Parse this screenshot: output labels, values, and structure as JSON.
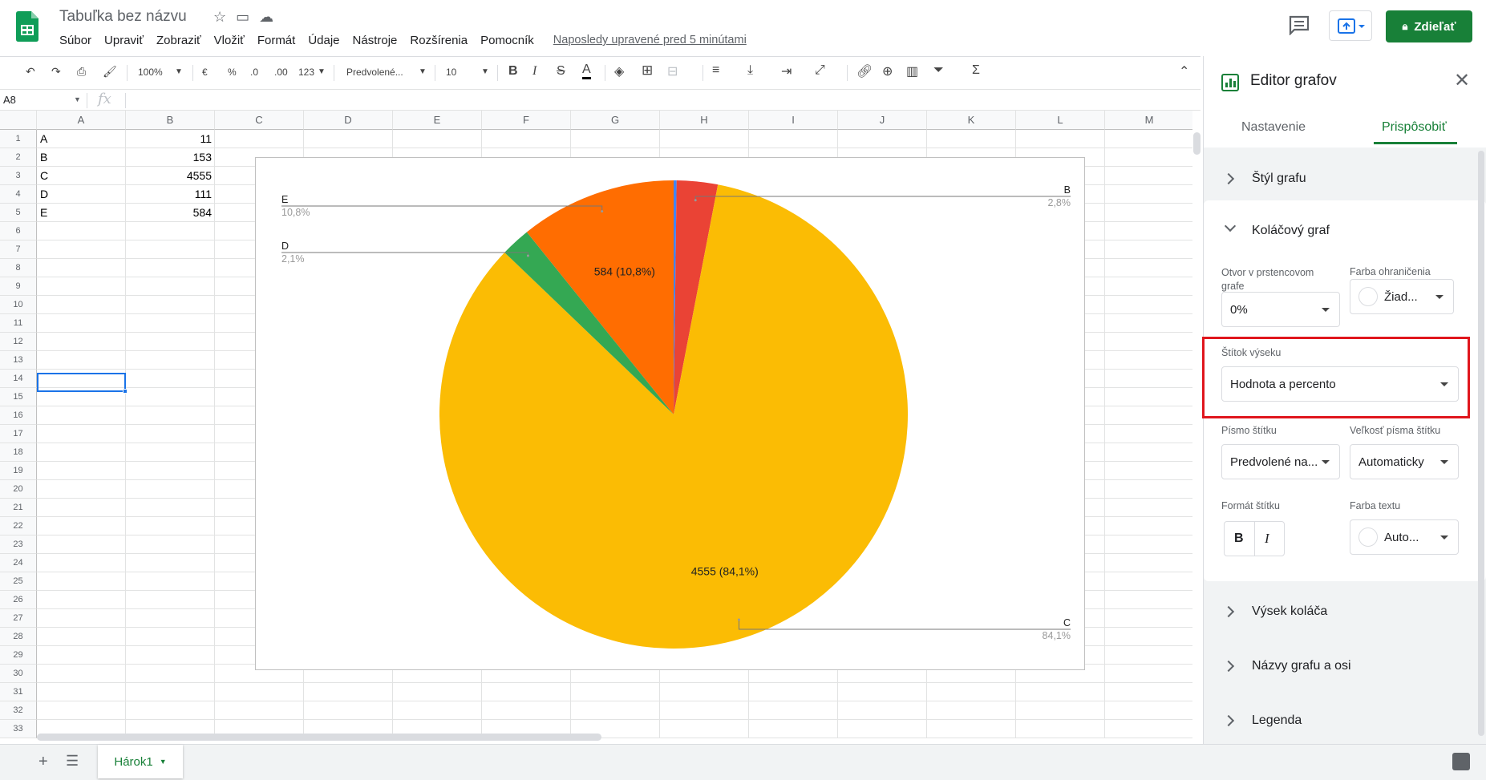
{
  "header": {
    "doc_title": "Tabuľka bez názvu",
    "menu": [
      "Súbor",
      "Upraviť",
      "Zobraziť",
      "Vložiť",
      "Formát",
      "Údaje",
      "Nástroje",
      "Rozšírenia",
      "Pomocník"
    ],
    "last_edit": "Naposledy upravené pred 5 minútami",
    "share_label": "Zdieľať"
  },
  "toolbar": {
    "zoom": "100%",
    "currency": "€",
    "percent": "%",
    "dec_decrease": ".0",
    "dec_increase": ".00",
    "format_more": "123",
    "font": "Predvolené...",
    "font_size": "10"
  },
  "formula_bar": {
    "namebox": "A8",
    "fx": "fx"
  },
  "grid": {
    "columns": [
      "A",
      "B",
      "C",
      "D",
      "E",
      "F",
      "G",
      "H",
      "I",
      "J",
      "K",
      "L",
      "M"
    ],
    "row_count": 33,
    "data": [
      {
        "label": "A",
        "value": "11"
      },
      {
        "label": "B",
        "value": "153"
      },
      {
        "label": "C",
        "value": "4555"
      },
      {
        "label": "D",
        "value": "111"
      },
      {
        "label": "E",
        "value": "584"
      }
    ]
  },
  "chart_data": {
    "type": "pie",
    "categories": [
      "A",
      "B",
      "C",
      "D",
      "E"
    ],
    "values": [
      11,
      153,
      4555,
      111,
      584
    ],
    "colors": [
      "#4285f4",
      "#ea4335",
      "#fbbc04",
      "#34a853",
      "#ff6d01"
    ],
    "inside_labels": {
      "C": "4555 (84,1%)",
      "E": "584 (10,8%)"
    },
    "outside_labels": [
      {
        "name": "B",
        "pct": "2,8%",
        "side": "right"
      },
      {
        "name": "E",
        "pct": "10,8%",
        "side": "left"
      },
      {
        "name": "D",
        "pct": "2,1%",
        "side": "left"
      },
      {
        "name": "C",
        "pct": "84,1%",
        "side": "right"
      }
    ]
  },
  "sheet_tab": "Hárok1",
  "panel": {
    "title": "Editor grafov",
    "tabs": [
      "Nastavenie",
      "Prispôsobiť"
    ],
    "active_tab": "Prispôsobiť",
    "sections": {
      "chart_style": "Štýl grafu",
      "pie_chart": "Koláčový graf",
      "pie_slice": "Výsek koláča",
      "titles": "Názvy grafu a osi",
      "legend": "Legenda"
    },
    "donut_hole_label": "Otvor v prstencovom grafe",
    "donut_hole_value": "0%",
    "border_color_label": "Farba ohraničenia",
    "border_color_value": "Žiad...",
    "slice_label_label": "Štítok výseku",
    "slice_label_value": "Hodnota a percento",
    "label_font_label": "Písmo štítku",
    "label_font_value": "Predvolené na...",
    "label_size_label": "Veľkosť písma štítku",
    "label_size_value": "Automaticky",
    "label_format_label": "Formát štítku",
    "bold": "B",
    "italic": "I",
    "text_color_label": "Farba textu",
    "text_color_value": "Auto..."
  }
}
